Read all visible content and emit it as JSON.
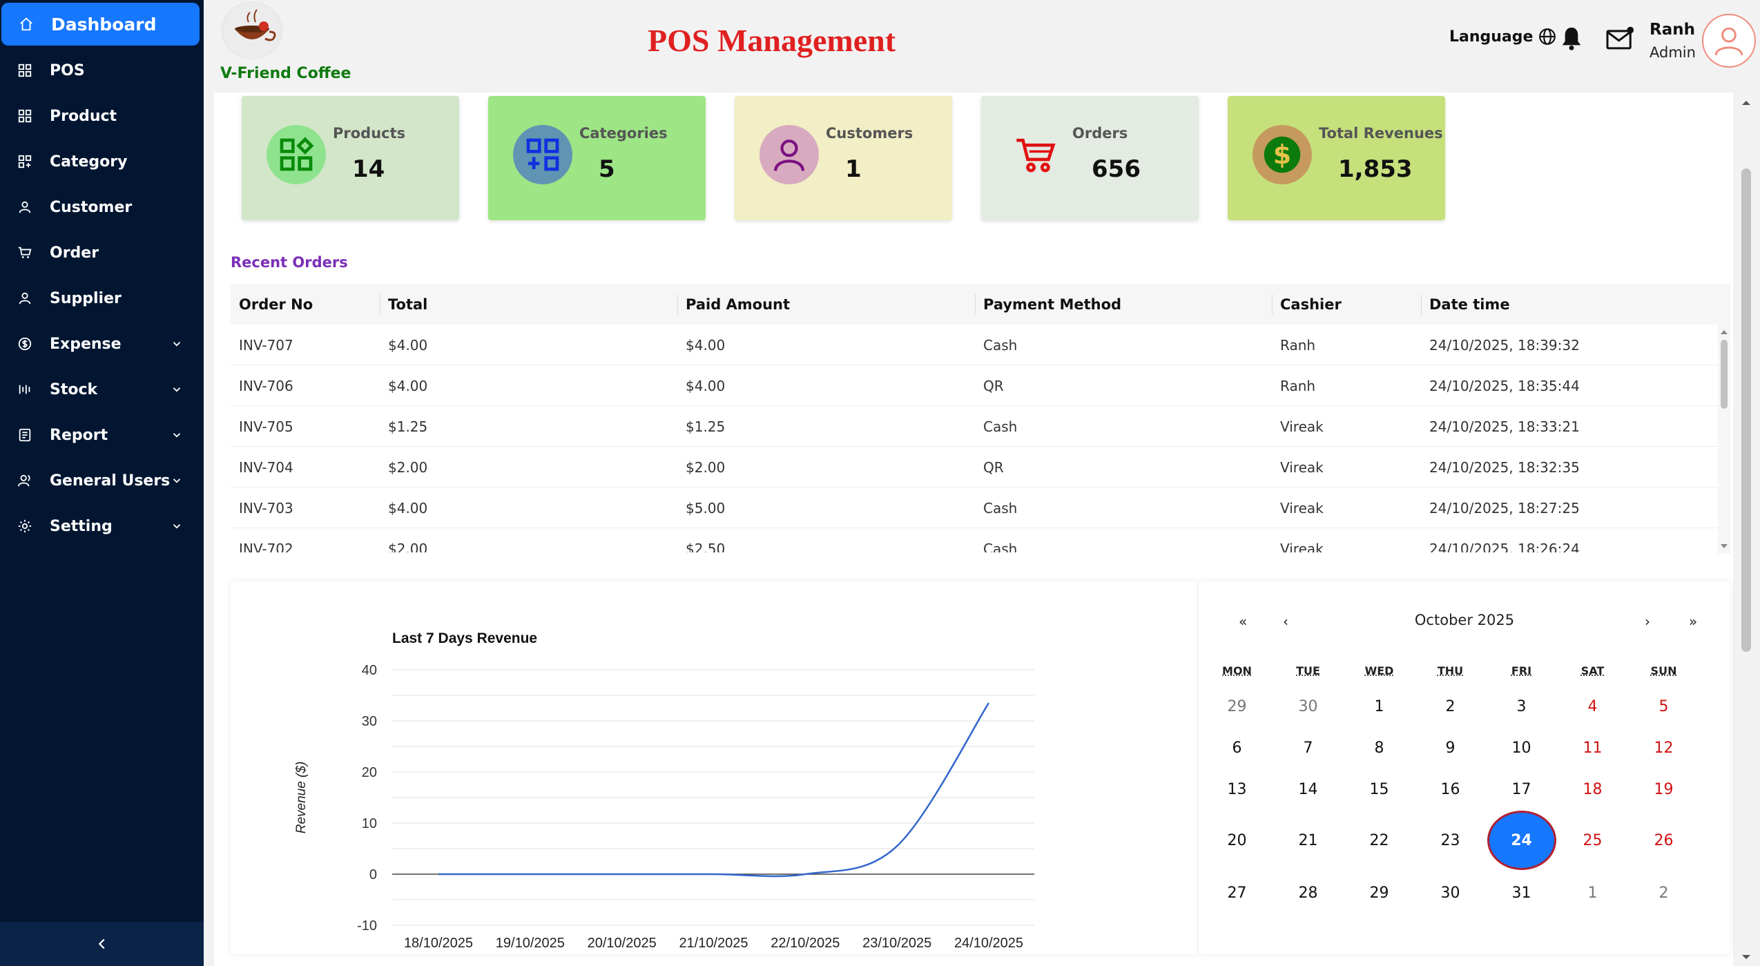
{
  "sidebar": {
    "items": [
      {
        "label": "Dashboard",
        "icon": "home-icon",
        "active": true
      },
      {
        "label": "POS",
        "icon": "grid-icon"
      },
      {
        "label": "Product",
        "icon": "grid-icon"
      },
      {
        "label": "Category",
        "icon": "category-icon"
      },
      {
        "label": "Customer",
        "icon": "user-icon"
      },
      {
        "label": "Order",
        "icon": "cart-icon"
      },
      {
        "label": "Supplier",
        "icon": "user-icon"
      },
      {
        "label": "Expense",
        "icon": "dollar-icon",
        "chevron": true
      },
      {
        "label": "Stock",
        "icon": "stock-icon",
        "chevron": true
      },
      {
        "label": "Report",
        "icon": "report-icon",
        "chevron": true
      },
      {
        "label": "General Users",
        "icon": "users-icon",
        "chevron": true
      },
      {
        "label": "Setting",
        "icon": "gear-icon",
        "chevron": true
      }
    ],
    "collapse_icon": "chevron-left-icon"
  },
  "header": {
    "brand": "V-Friend Coffee",
    "title": "POS Management",
    "language_label": "Language",
    "user": {
      "name": "Ranh",
      "role": "Admin"
    }
  },
  "stats": [
    {
      "label": "Products",
      "value": "14",
      "icon": "products-icon"
    },
    {
      "label": "Categories",
      "value": "5",
      "icon": "categories-icon"
    },
    {
      "label": "Customers",
      "value": "1",
      "icon": "customer-icon"
    },
    {
      "label": "Orders",
      "value": "656",
      "icon": "cart-icon"
    },
    {
      "label": "Total Revenues",
      "value": "1,853",
      "icon": "dollar-icon"
    }
  ],
  "orders": {
    "title": "Recent Orders",
    "columns": [
      "Order No",
      "Total",
      "Paid Amount",
      "Payment Method",
      "Cashier",
      "Date time"
    ],
    "rows": [
      [
        "INV-707",
        "$4.00",
        "$4.00",
        "Cash",
        "Ranh",
        "24/10/2025, 18:39:32"
      ],
      [
        "INV-706",
        "$4.00",
        "$4.00",
        "QR",
        "Ranh",
        "24/10/2025, 18:35:44"
      ],
      [
        "INV-705",
        "$1.25",
        "$1.25",
        "Cash",
        "Vireak",
        "24/10/2025, 18:33:21"
      ],
      [
        "INV-704",
        "$2.00",
        "$2.00",
        "QR",
        "Vireak",
        "24/10/2025, 18:32:35"
      ],
      [
        "INV-703",
        "$4.00",
        "$5.00",
        "Cash",
        "Vireak",
        "24/10/2025, 18:27:25"
      ],
      [
        "INV-702",
        "$2.00",
        "$2.50",
        "Cash",
        "Vireak",
        "24/10/2025, 18:26:24"
      ]
    ]
  },
  "chart_data": {
    "type": "line",
    "title": "Last 7 Days Revenue",
    "xlabel": "",
    "ylabel": "Revenue ($)",
    "categories": [
      "18/10/2025",
      "19/10/2025",
      "20/10/2025",
      "21/10/2025",
      "22/10/2025",
      "23/10/2025",
      "24/10/2025"
    ],
    "series": [
      {
        "values": [
          0,
          0,
          0,
          0,
          0,
          5.5,
          33.5
        ]
      }
    ],
    "yticks": [
      40,
      30,
      20,
      10,
      0,
      -10
    ],
    "ylim": [
      -10,
      40
    ],
    "grid": true,
    "line_color": "#3366cc"
  },
  "calendar": {
    "prev_year": "«",
    "prev_month": "‹",
    "next_month": "›",
    "next_year": "»",
    "month_label": "October 2025",
    "weekdays": [
      "MON",
      "TUE",
      "WED",
      "THU",
      "FRI",
      "SAT",
      "SUN"
    ],
    "weeks": [
      [
        "29",
        "30",
        "1",
        "2",
        "3",
        "4",
        "5"
      ],
      [
        "6",
        "7",
        "8",
        "9",
        "10",
        "11",
        "12"
      ],
      [
        "13",
        "14",
        "15",
        "16",
        "17",
        "18",
        "19"
      ],
      [
        "20",
        "21",
        "22",
        "23",
        "24",
        "25",
        "26"
      ],
      [
        "27",
        "28",
        "29",
        "30",
        "31",
        "1",
        "2"
      ]
    ],
    "today": "24"
  },
  "colors": {
    "sidebar_bg": "#021631",
    "active": "#1677ff",
    "title_red": "#e02020",
    "brand_green": "#107a10",
    "section_purple": "#7b2fb8"
  }
}
